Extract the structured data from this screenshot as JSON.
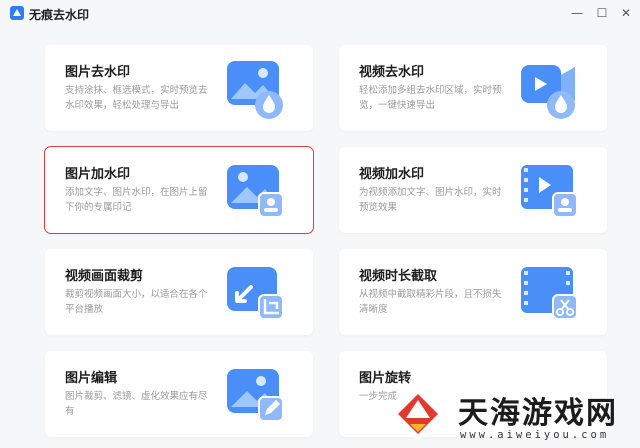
{
  "app": {
    "title": "无痕去水印",
    "window_controls": {
      "minimize": "—",
      "maximize": "☐",
      "close": "✕"
    }
  },
  "cards": [
    {
      "title": "图片去水印",
      "desc": "支持涂抹、框选模式，实时预览去水印效果，轻松处理与导出"
    },
    {
      "title": "视频去水印",
      "desc": "轻松添加多组去水印区域，实时预览，一键快速导出"
    },
    {
      "title": "图片加水印",
      "desc": "添加文字、图片水印，在图片上留下你的专属印记"
    },
    {
      "title": "视频加水印",
      "desc": "为视频添加文字、图片水印，实时预览效果"
    },
    {
      "title": "视频画面裁剪",
      "desc": "裁剪视频画面大小，以适合在各个平台播放"
    },
    {
      "title": "视频时长截取",
      "desc": "从视频中截取精彩片段，且不损失清晰度"
    },
    {
      "title": "图片编辑",
      "desc": "图片裁剪、滤镜、虚化效果应有尽有"
    },
    {
      "title": "图片旋转",
      "desc": "一步完成"
    }
  ],
  "overlay": {
    "site_name": "天海游戏网",
    "site_url": "www.aiweiyou.com"
  },
  "colors": {
    "accent": "#3f86f5",
    "selected_border": "#e04040",
    "background": "#f6f7f9"
  }
}
